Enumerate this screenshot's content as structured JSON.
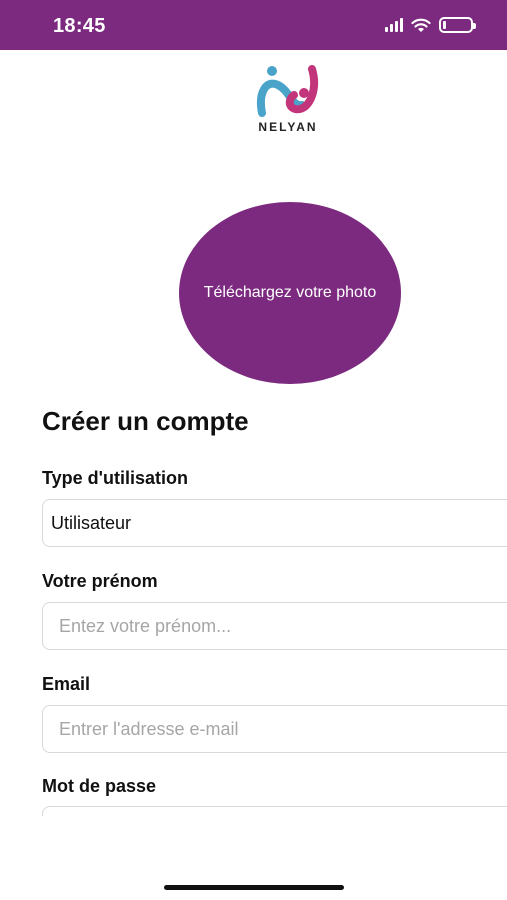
{
  "status_bar": {
    "time": "18:45",
    "icons": [
      "cellular-signal-icon",
      "wifi-icon",
      "battery-icon"
    ],
    "battery_level": 0.1
  },
  "logo": {
    "text": "NELYAN"
  },
  "upload": {
    "label": "Téléchargez votre photo"
  },
  "form": {
    "title": "Créer un compte",
    "usage_type": {
      "label": "Type d'utilisation",
      "value": "Utilisateur"
    },
    "first_name": {
      "label": "Votre prénom",
      "placeholder": "Entez votre prénom..."
    },
    "email": {
      "label": "Email",
      "placeholder": "Entrer l'adresse e-mail"
    },
    "password": {
      "label": "Mot de passe",
      "placeholder": ""
    }
  },
  "colors": {
    "brand": "#7b2a7f",
    "logo_blue": "#4aa3c8",
    "logo_pink": "#c2357a"
  }
}
